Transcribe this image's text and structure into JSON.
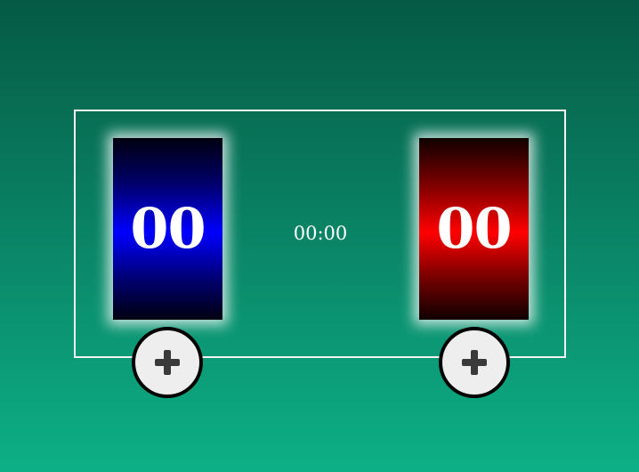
{
  "scoreboard": {
    "home": {
      "score": "00",
      "color": "#0000ff",
      "add_icon": "plus-icon"
    },
    "away": {
      "score": "00",
      "color": "#ff0000",
      "add_icon": "plus-icon"
    },
    "timer": "00:00"
  },
  "colors": {
    "background_top": "#055a44",
    "background_bottom": "#0db086",
    "frame": "#f2f2f2"
  }
}
